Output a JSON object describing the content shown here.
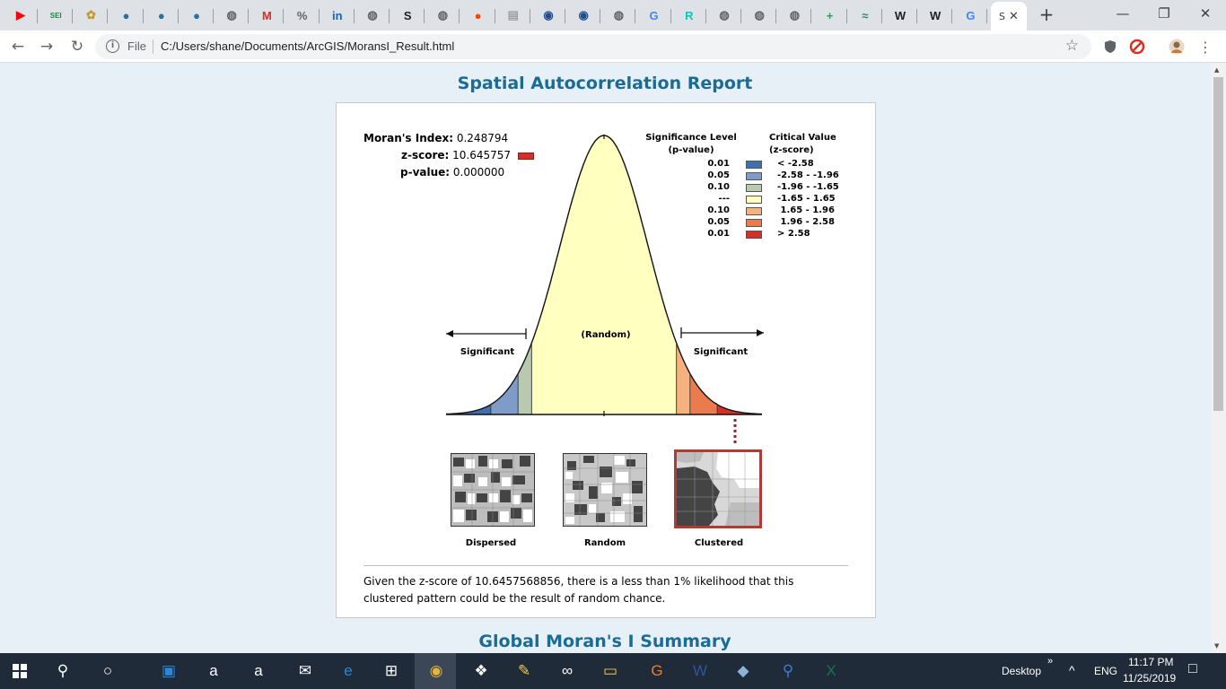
{
  "browser": {
    "tabs": [
      {
        "icon": "youtube-icon",
        "glyph": "▶",
        "color": "#ff0000"
      },
      {
        "icon": "sei-icon",
        "glyph": "SEI",
        "color": "#1a8a3a"
      },
      {
        "icon": "emblem-icon",
        "glyph": "✿",
        "color": "#c49a2c"
      },
      {
        "icon": "globe-icon",
        "glyph": "●",
        "color": "#2b6f9e"
      },
      {
        "icon": "globe-icon",
        "glyph": "●",
        "color": "#2b6f9e"
      },
      {
        "icon": "globe-icon",
        "glyph": "●",
        "color": "#2b6f9e"
      },
      {
        "icon": "world-icon",
        "glyph": "◍",
        "color": "#5f6368"
      },
      {
        "icon": "gmail-icon",
        "glyph": "M",
        "color": "#d93025"
      },
      {
        "icon": "percent-icon",
        "glyph": "%",
        "color": "#5f6368"
      },
      {
        "icon": "linkedin-icon",
        "glyph": "in",
        "color": "#0a66c2"
      },
      {
        "icon": "world-icon",
        "glyph": "◍",
        "color": "#5f6368"
      },
      {
        "icon": "s-icon",
        "glyph": "S",
        "color": "#202124"
      },
      {
        "icon": "world-icon",
        "glyph": "◍",
        "color": "#5f6368"
      },
      {
        "icon": "reddit-icon",
        "glyph": "●",
        "color": "#ff4500"
      },
      {
        "icon": "document-icon",
        "glyph": "▤",
        "color": "#9aa0a6"
      },
      {
        "icon": "un-icon",
        "glyph": "◉",
        "color": "#1f4e8c"
      },
      {
        "icon": "un-icon",
        "glyph": "◉",
        "color": "#1f4e8c"
      },
      {
        "icon": "world-icon",
        "glyph": "◍",
        "color": "#5f6368"
      },
      {
        "icon": "google-icon",
        "glyph": "G",
        "color": "#4285f4"
      },
      {
        "icon": "researchgate-icon",
        "glyph": "R",
        "color": "#00ccbb"
      },
      {
        "icon": "world-icon",
        "glyph": "◍",
        "color": "#5f6368"
      },
      {
        "icon": "world-icon",
        "glyph": "◍",
        "color": "#5f6368"
      },
      {
        "icon": "world-icon",
        "glyph": "◍",
        "color": "#5f6368"
      },
      {
        "icon": "plus-cross-icon",
        "glyph": "+",
        "color": "#2e9e4f"
      },
      {
        "icon": "esri-icon",
        "glyph": "≈",
        "color": "#2a8a6e"
      },
      {
        "icon": "wikipedia-icon",
        "glyph": "W",
        "color": "#202124"
      },
      {
        "icon": "wikipedia-icon",
        "glyph": "W",
        "color": "#202124"
      },
      {
        "icon": "google-icon",
        "glyph": "G",
        "color": "#4285f4"
      }
    ],
    "active_tab": {
      "label": "S",
      "close": "✕"
    },
    "new_tab": "+",
    "window_controls": {
      "minimize": "—",
      "restore": "❐",
      "close": "✕"
    },
    "nav": {
      "back": "←",
      "forward": "→",
      "reload": "↻"
    },
    "address": {
      "scheme": "File",
      "url": "C:/Users/shane/Documents/ArcGIS/MoransI_Result.html",
      "star": "☆"
    }
  },
  "report": {
    "title": "Spatial Autocorrelation Report",
    "morans_index_label": "Moran's Index:",
    "morans_index_value": "0.248794",
    "zscore_label": "z-score:",
    "zscore_value": "10.645757",
    "pvalue_label": "p-value:",
    "pvalue_value": "0.000000",
    "legend": {
      "sig_header_1": "Significance Level",
      "sig_header_2": "(p-value)",
      "crit_header_1": "Critical Value",
      "crit_header_2": "(z-score)",
      "rows": [
        {
          "p": "0.01",
          "z": "< -2.58",
          "color": "#3f6fb0"
        },
        {
          "p": "0.05",
          "z": "-2.58 - -1.96",
          "color": "#7f9cc8"
        },
        {
          "p": "0.10",
          "z": "-1.96 - -1.65",
          "color": "#b9c9b0"
        },
        {
          "p": "---",
          "z": "-1.65 - 1.65",
          "color": "#ffffc0"
        },
        {
          "p": "0.10",
          "z": " 1.65 - 1.96",
          "color": "#f6b27e"
        },
        {
          "p": "0.05",
          "z": " 1.96 - 2.58",
          "color": "#ec7a4f"
        },
        {
          "p": "0.01",
          "z": "> 2.58",
          "color": "#d62f2a"
        }
      ]
    },
    "curve_labels": {
      "left": "Significant",
      "center": "(Random)",
      "right": "Significant"
    },
    "maps": [
      {
        "label": "Dispersed"
      },
      {
        "label": "Random"
      },
      {
        "label": "Clustered"
      }
    ],
    "summary": "Given the z-score of 10.6457568856, there is a less than 1% likelihood that this clustered pattern could be the result of random chance.",
    "next_section": "Global Moran's I Summary"
  },
  "taskbar": {
    "apps": [
      {
        "icon": "search-icon",
        "glyph": "⚲"
      },
      {
        "icon": "cortana-icon",
        "glyph": "○"
      },
      {
        "icon": "media-player-icon",
        "glyph": "▣"
      },
      {
        "icon": "amazon-icon",
        "glyph": "a"
      },
      {
        "icon": "amazon-icon",
        "glyph": "a"
      },
      {
        "icon": "mail-icon",
        "glyph": "✉"
      },
      {
        "icon": "edge-icon",
        "glyph": "e"
      },
      {
        "icon": "store-icon",
        "glyph": "⊞"
      },
      {
        "icon": "chrome-icon",
        "glyph": "◉"
      },
      {
        "icon": "dropbox-icon",
        "glyph": "❖"
      },
      {
        "icon": "paint-icon",
        "glyph": "✎"
      },
      {
        "icon": "tripadvisor-icon",
        "glyph": "∞"
      },
      {
        "icon": "file-explorer-icon",
        "glyph": "▭"
      },
      {
        "icon": "pdf-icon",
        "glyph": "G"
      },
      {
        "icon": "word-icon",
        "glyph": "W"
      },
      {
        "icon": "sticky-icon",
        "glyph": "◆"
      },
      {
        "icon": "magnifier-icon",
        "glyph": "⚲"
      },
      {
        "icon": "excel-icon",
        "glyph": "X"
      }
    ],
    "desktop": "Desktop",
    "chevron": "»",
    "up_arrow": "^",
    "lang": "ENG",
    "time": "11:17 PM",
    "date": "11/25/2019",
    "notification": "□"
  }
}
